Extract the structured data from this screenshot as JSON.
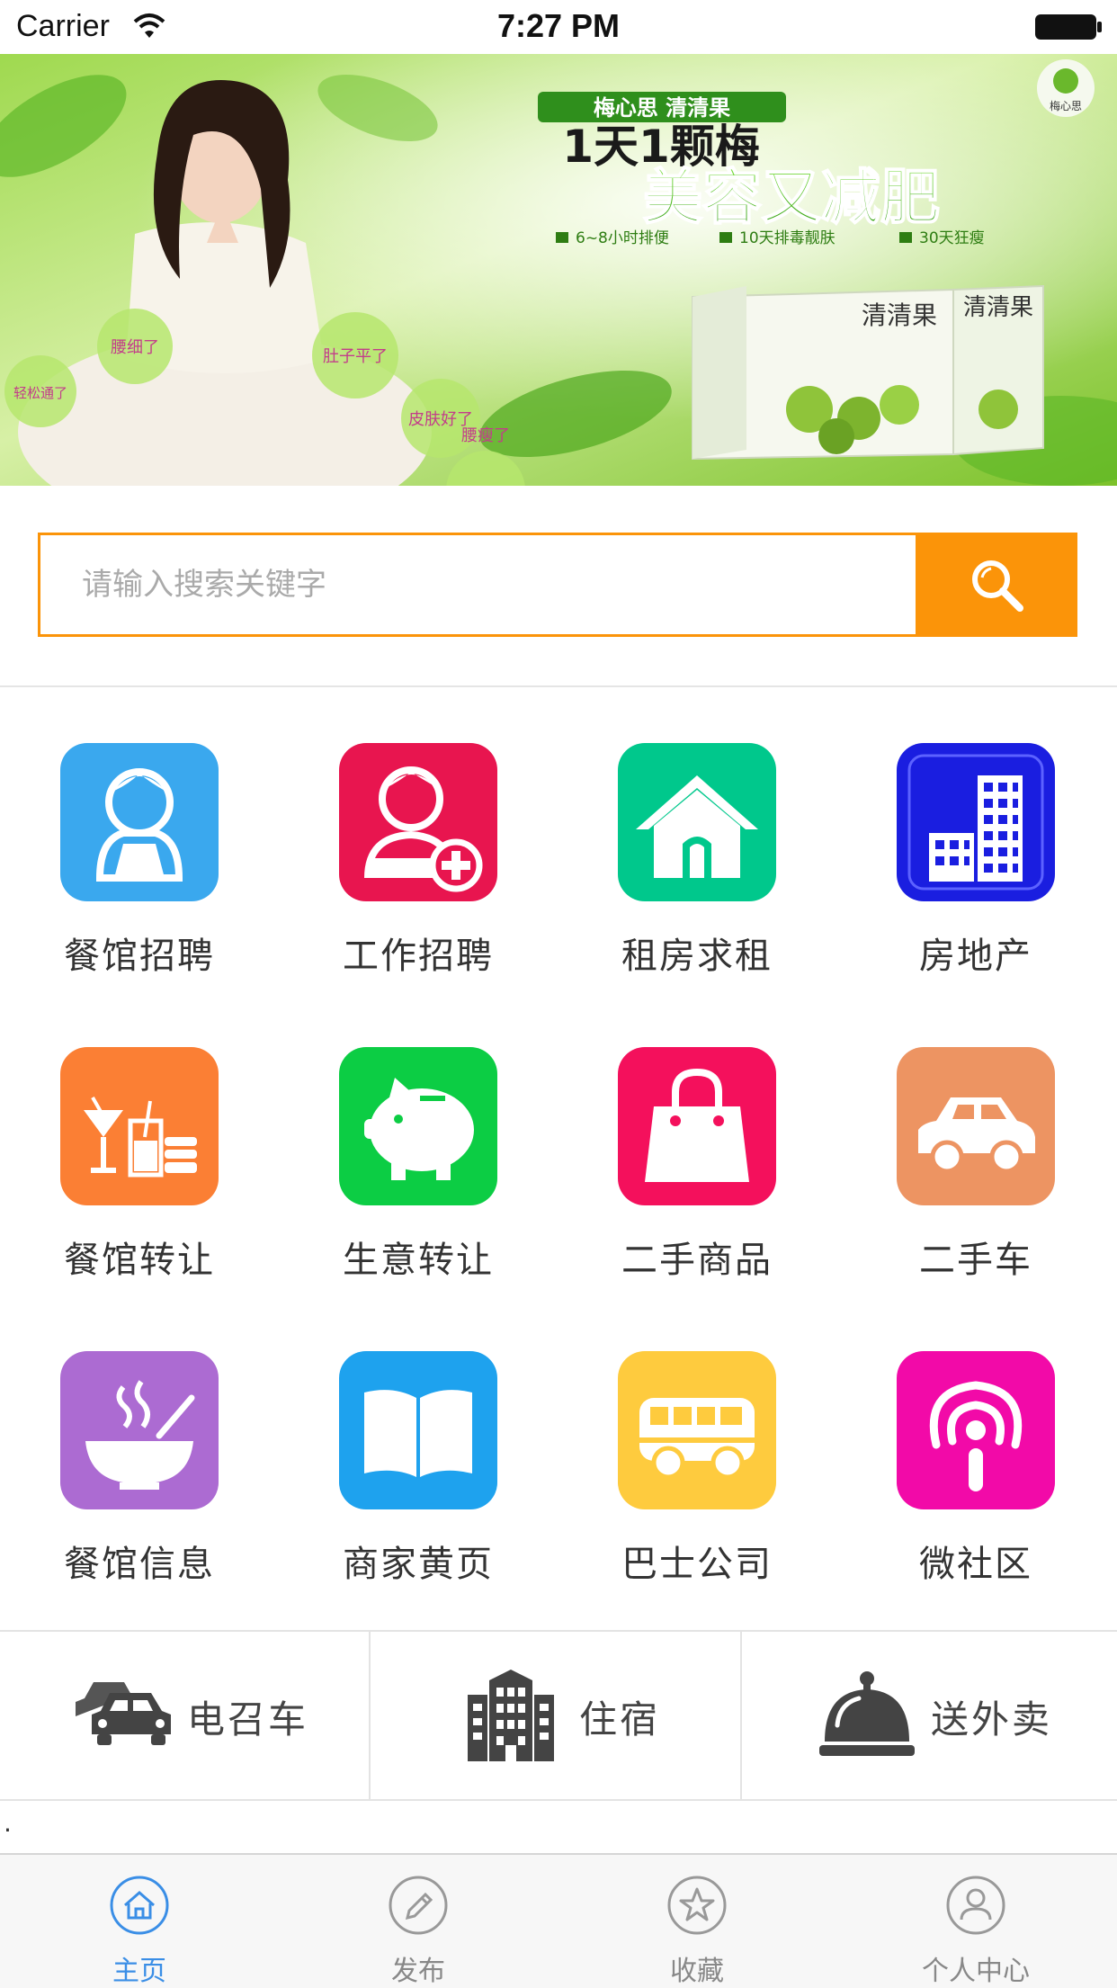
{
  "status_bar": {
    "carrier": "Carrier",
    "time": "7:27 PM"
  },
  "banner": {
    "brand_tag": "梅心思  清清果",
    "headline": "1天1颗梅",
    "slogan": "美容又减肥",
    "benefits": [
      "6~8小时排便",
      "10天排毒靓肤",
      "30天狂瘦"
    ],
    "bubbles": [
      "腰细了",
      "肚子平了",
      "皮肤好了",
      "轻松通了",
      "腰瘦了"
    ],
    "box_text": "清清果",
    "logo_text": "梅心思"
  },
  "search": {
    "placeholder": "请输入搜索关键字",
    "accent": "#fb9409"
  },
  "categories": [
    {
      "label": "餐馆招聘",
      "icon": "waiter-icon",
      "color": "#3aa8ee"
    },
    {
      "label": "工作招聘",
      "icon": "add-user-icon",
      "color": "#e8154f"
    },
    {
      "label": "租房求租",
      "icon": "house-icon",
      "color": "#00c88c"
    },
    {
      "label": "房地产",
      "icon": "buildings-icon",
      "color": "#1a1ee0"
    },
    {
      "label": "餐馆转让",
      "icon": "drinks-icon",
      "color": "#fb7f34"
    },
    {
      "label": "生意转让",
      "icon": "piggy-bank-icon",
      "color": "#0ccd44"
    },
    {
      "label": "二手商品",
      "icon": "shopping-bag-icon",
      "color": "#f4105c"
    },
    {
      "label": "二手车",
      "icon": "car-icon",
      "color": "#ed9462"
    },
    {
      "label": "餐馆信息",
      "icon": "bowl-icon",
      "color": "#ac6bd2"
    },
    {
      "label": "商家黄页",
      "icon": "book-icon",
      "color": "#1ea2ee"
    },
    {
      "label": "巴士公司",
      "icon": "bus-icon",
      "color": "#fecb3e"
    },
    {
      "label": "微社区",
      "icon": "community-icon",
      "color": "#f20aa8"
    }
  ],
  "quick_links": [
    {
      "label": "电召车",
      "icon": "taxi-icon"
    },
    {
      "label": "住宿",
      "icon": "hotel-icon"
    },
    {
      "label": "送外卖",
      "icon": "food-cloche-icon"
    }
  ],
  "footer_mark": ".",
  "tabs": [
    {
      "label": "主页",
      "icon": "home-icon",
      "active": true
    },
    {
      "label": "发布",
      "icon": "pencil-icon",
      "active": false
    },
    {
      "label": "收藏",
      "icon": "star-icon",
      "active": false
    },
    {
      "label": "个人中心",
      "icon": "user-icon",
      "active": false
    }
  ],
  "colors": {
    "active_tab": "#3a8ee6",
    "inactive_tab": "#888888"
  }
}
